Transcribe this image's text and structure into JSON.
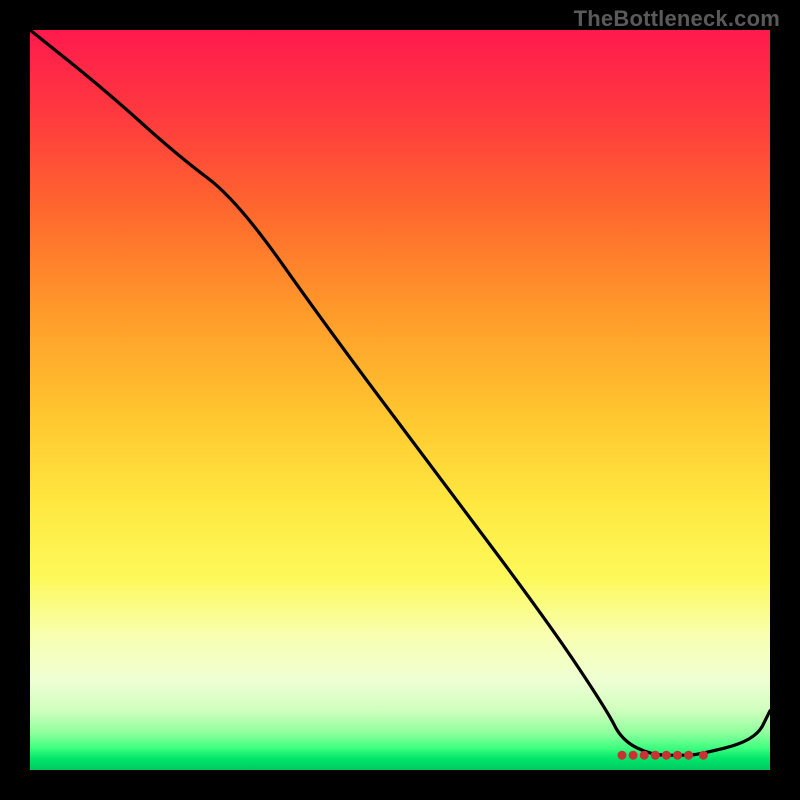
{
  "watermark": "TheBottleneck.com",
  "chart_data": {
    "type": "line",
    "title": "",
    "xlabel": "",
    "ylabel": "",
    "xlim": [
      0,
      100
    ],
    "ylim": [
      0,
      100
    ],
    "grid": false,
    "legend": false,
    "series": [
      {
        "name": "curve",
        "x": [
          0,
          10,
          20,
          28,
          40,
          55,
          70,
          78,
          80,
          84,
          88,
          90,
          98,
          100
        ],
        "y": [
          100,
          92,
          83,
          77,
          60,
          40,
          20,
          8,
          4,
          2,
          2,
          2,
          4,
          8
        ]
      }
    ],
    "markers": [
      {
        "x": 80,
        "y": 2,
        "color": "#c83232"
      },
      {
        "x": 81.5,
        "y": 2,
        "color": "#c83232"
      },
      {
        "x": 83,
        "y": 2,
        "color": "#c83232"
      },
      {
        "x": 84.5,
        "y": 2,
        "color": "#c83232"
      },
      {
        "x": 86,
        "y": 2,
        "color": "#c83232"
      },
      {
        "x": 87.5,
        "y": 2,
        "color": "#c83232"
      },
      {
        "x": 89,
        "y": 2,
        "color": "#c83232"
      },
      {
        "x": 91,
        "y": 2,
        "color": "#c83232"
      }
    ],
    "colors": {
      "line": "#000000",
      "marker": "#c83232"
    }
  }
}
